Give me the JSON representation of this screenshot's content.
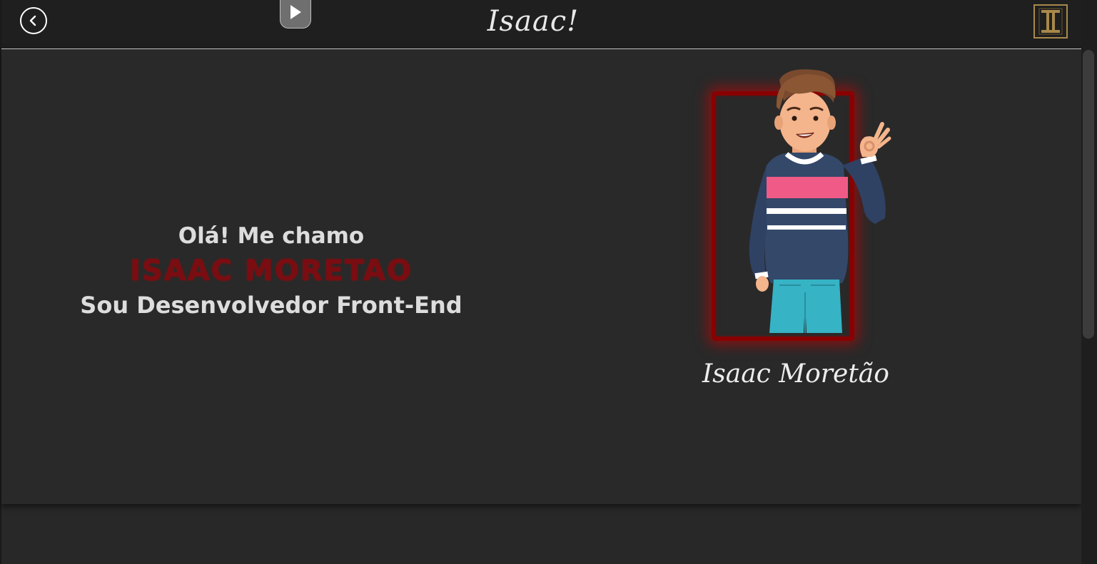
{
  "header": {
    "brand_title": "Isaac!",
    "back_icon": "chevron-left-icon",
    "play_icon": "play-icon",
    "logo_letter": "I",
    "logo_color": "#a8894a"
  },
  "hero": {
    "greeting": "Olá! Me chamo",
    "name": "ISAAC MORETAO",
    "role": "Sou Desenvolvedor Front-End",
    "name_color": "#7a0d12"
  },
  "portrait": {
    "signature": "Isaac Moretão",
    "frame_color": "#8a0000",
    "avatar_icon": "waving-man-illustration"
  }
}
